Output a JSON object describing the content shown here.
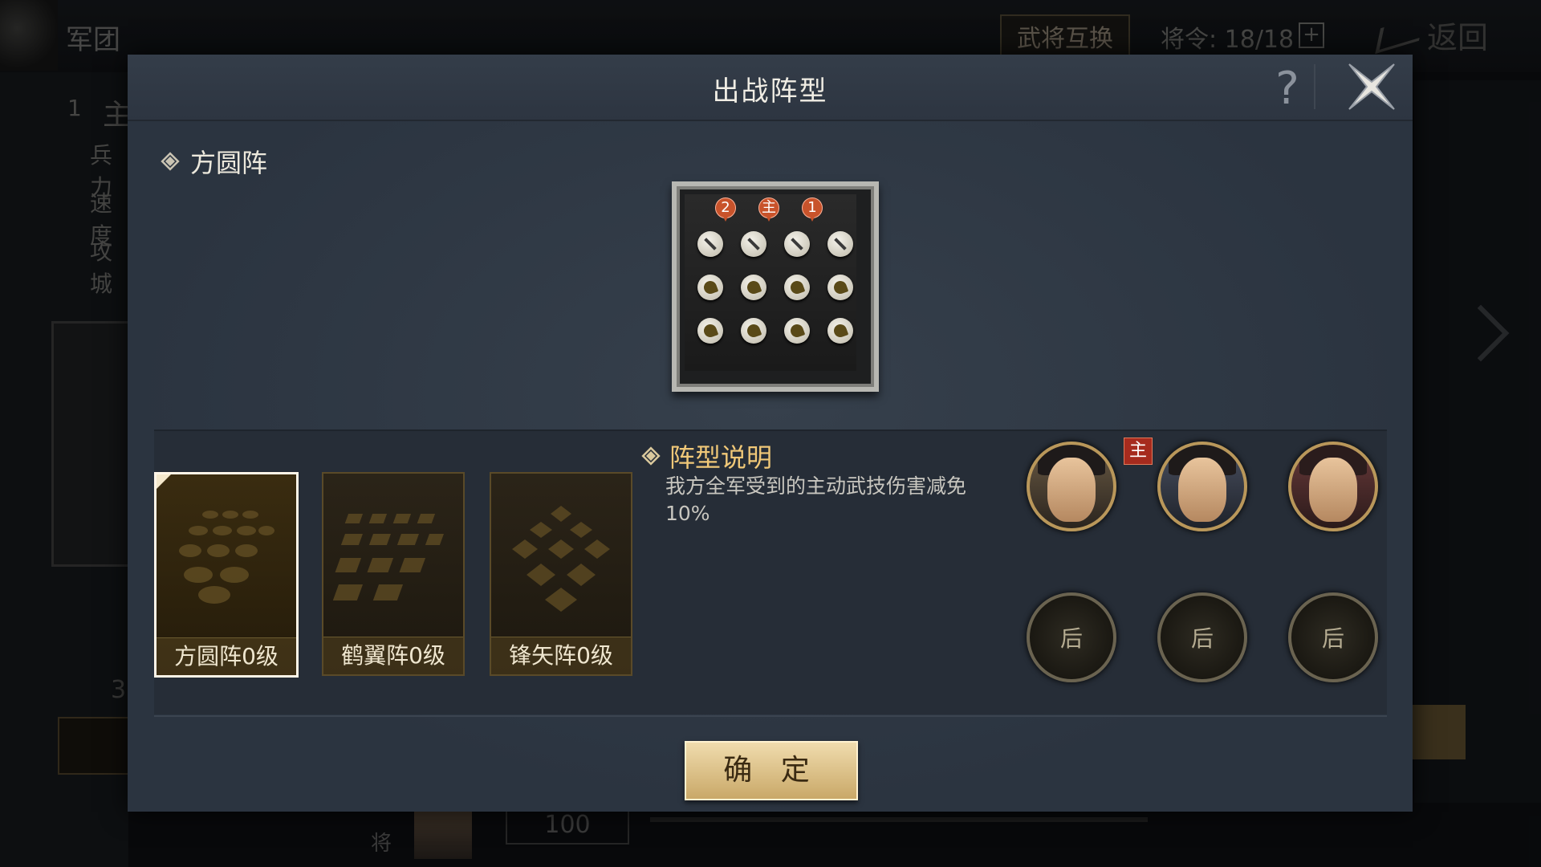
{
  "background": {
    "title": "军团",
    "swap_button": "武将互换",
    "orders": "将令: 18/18",
    "plus": "+",
    "back": "返回",
    "side_index": "1",
    "side_label_1": "主",
    "side_items": [
      "兵力",
      "速度",
      "攻城"
    ],
    "left_count": "3",
    "bottom_label": "将",
    "bottom_count": "100"
  },
  "dialog": {
    "title": "出战阵型",
    "help_symbol": "?",
    "formation_title": "方圆阵",
    "board_markers": [
      "2",
      "主",
      "1"
    ],
    "formations": [
      {
        "label": "方圆阵0级",
        "selected": true
      },
      {
        "label": "鹤翼阵0级",
        "selected": false
      },
      {
        "label": "锋矢阵0级",
        "selected": false
      }
    ],
    "description_title": "阵型说明",
    "description_text": "我方全军受到的主动武技伤害减免10%",
    "lord_badge": "主",
    "rear_slots": [
      "后",
      "后",
      "后"
    ],
    "confirm_label": "确 定"
  },
  "colors": {
    "dialog_bg": "#2b3440",
    "accent_gold": "#f0c878",
    "confirm_bg": "#e3c88e",
    "marker_red": "#c8532b"
  }
}
